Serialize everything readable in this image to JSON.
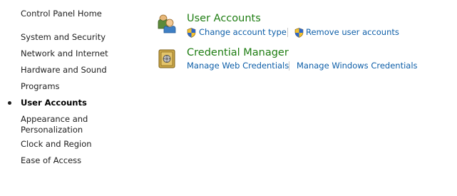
{
  "sidebar": {
    "home_label": "Control Panel Home",
    "items": [
      {
        "label": "System and Security"
      },
      {
        "label": "Network and Internet"
      },
      {
        "label": "Hardware and Sound"
      },
      {
        "label": "Programs"
      },
      {
        "label": "User Accounts",
        "active": true
      },
      {
        "label_line1": "Appearance and",
        "label_line2": "Personalization"
      },
      {
        "label": "Clock and Region"
      },
      {
        "label": "Ease of Access"
      }
    ]
  },
  "main": {
    "categories": [
      {
        "title": "User Accounts",
        "icon": "user-accounts-icon",
        "tasks": [
          {
            "label": "Change account type",
            "icon": "uac-shield-icon"
          },
          {
            "label": "Remove user accounts",
            "icon": "uac-shield-icon"
          }
        ]
      },
      {
        "title": "Credential Manager",
        "icon": "credential-vault-icon",
        "tasks": [
          {
            "label": "Manage Web Credentials"
          },
          {
            "label": "Manage Windows Credentials"
          }
        ]
      }
    ]
  },
  "colors": {
    "category_title": "#1e7d12",
    "task_link": "#0d5ea8",
    "sidebar_text": "#1e1e1e"
  }
}
